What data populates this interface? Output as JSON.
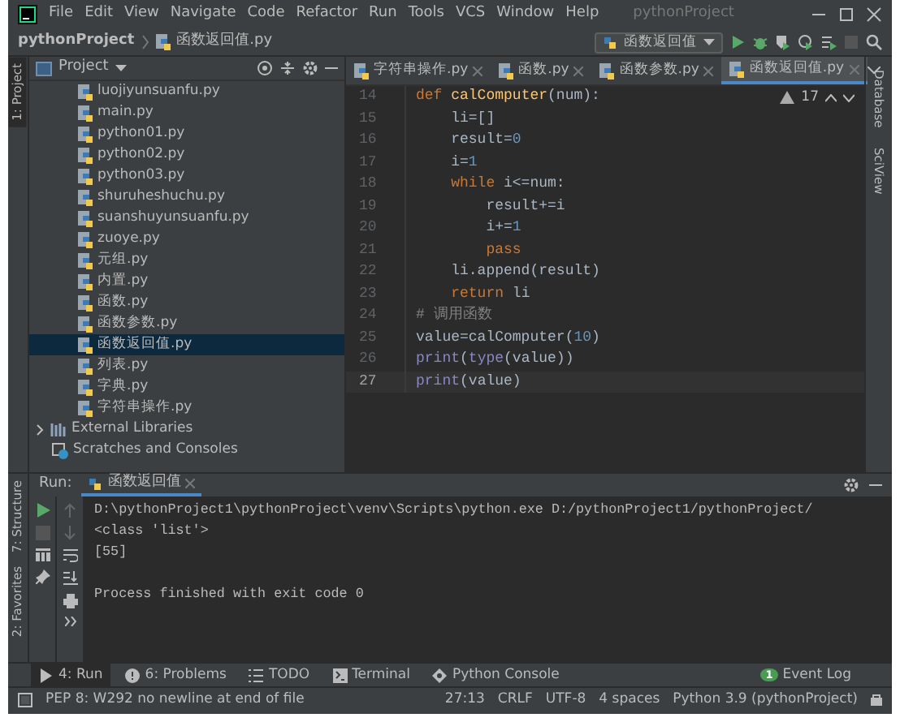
{
  "title_bar": {
    "menu": [
      "File",
      "Edit",
      "View",
      "Navigate",
      "Code",
      "Refactor",
      "Run",
      "Tools",
      "VCS",
      "Window",
      "Help"
    ],
    "title": "pythonProject"
  },
  "nav_bar": {
    "breadcrumb": [
      "pythonProject",
      "函数返回值.py"
    ],
    "run_config": "函数返回值"
  },
  "left_stripe": {
    "top": [
      "1: Project"
    ],
    "bottom": [
      "7: Structure",
      "2: Favorites"
    ]
  },
  "project_panel": {
    "title": "Project",
    "files": [
      {
        "label": "luojiyunsuanfu.py",
        "selected": false
      },
      {
        "label": "main.py",
        "selected": false
      },
      {
        "label": "python01.py",
        "selected": false
      },
      {
        "label": "python02.py",
        "selected": false
      },
      {
        "label": "python03.py",
        "selected": false
      },
      {
        "label": "shuruheshuchu.py",
        "selected": false
      },
      {
        "label": "suanshuyunsuanfu.py",
        "selected": false
      },
      {
        "label": "zuoye.py",
        "selected": false
      },
      {
        "label": "元组.py",
        "selected": false
      },
      {
        "label": "内置.py",
        "selected": false
      },
      {
        "label": "函数.py",
        "selected": false
      },
      {
        "label": "函数参数.py",
        "selected": false
      },
      {
        "label": "函数返回值.py",
        "selected": true
      },
      {
        "label": "列表.py",
        "selected": false
      },
      {
        "label": "字典.py",
        "selected": false
      },
      {
        "label": "字符串操作.py",
        "selected": false
      }
    ],
    "extras": [
      {
        "label": "External Libraries",
        "kind": "libraries"
      },
      {
        "label": "Scratches and Consoles",
        "kind": "scratches"
      }
    ]
  },
  "editor": {
    "tabs": [
      {
        "label": "字符串操作.py",
        "selected": false
      },
      {
        "label": "函数.py",
        "selected": false
      },
      {
        "label": "函数参数.py",
        "selected": false
      },
      {
        "label": "函数返回值.py",
        "selected": true
      }
    ],
    "warning_count": "17",
    "lines": [
      {
        "number": "14",
        "current": false,
        "tokens": [
          {
            "kind": "keyword",
            "text": "def "
          },
          {
            "kind": "function",
            "text": "calComputer"
          },
          {
            "kind": "plain",
            "text": "(num):"
          }
        ]
      },
      {
        "number": "15",
        "current": false,
        "tokens": [
          {
            "kind": "plain",
            "text": "    li=[]"
          }
        ]
      },
      {
        "number": "16",
        "current": false,
        "tokens": [
          {
            "kind": "plain",
            "text": "    result="
          },
          {
            "kind": "number",
            "text": "0"
          }
        ]
      },
      {
        "number": "17",
        "current": false,
        "tokens": [
          {
            "kind": "plain",
            "text": "    i="
          },
          {
            "kind": "number",
            "text": "1"
          }
        ]
      },
      {
        "number": "18",
        "current": false,
        "tokens": [
          {
            "kind": "keyword",
            "text": "    while"
          },
          {
            "kind": "plain",
            "text": " i<=num:"
          }
        ]
      },
      {
        "number": "19",
        "current": false,
        "tokens": [
          {
            "kind": "plain",
            "text": "        result+=i"
          }
        ]
      },
      {
        "number": "20",
        "current": false,
        "tokens": [
          {
            "kind": "plain",
            "text": "        i+="
          },
          {
            "kind": "number",
            "text": "1"
          }
        ]
      },
      {
        "number": "21",
        "current": false,
        "tokens": [
          {
            "kind": "keyword",
            "text": "        pass"
          }
        ]
      },
      {
        "number": "22",
        "current": false,
        "tokens": [
          {
            "kind": "plain",
            "text": "    li.append(result)"
          }
        ]
      },
      {
        "number": "23",
        "current": false,
        "tokens": [
          {
            "kind": "keyword",
            "text": "    return"
          },
          {
            "kind": "plain",
            "text": " li"
          }
        ]
      },
      {
        "number": "24",
        "current": false,
        "tokens": [
          {
            "kind": "comment",
            "text": "# 调用函数"
          }
        ]
      },
      {
        "number": "25",
        "current": false,
        "tokens": [
          {
            "kind": "plain",
            "text": "value=calComputer("
          },
          {
            "kind": "number",
            "text": "10"
          },
          {
            "kind": "plain",
            "text": ")"
          }
        ]
      },
      {
        "number": "26",
        "current": false,
        "tokens": [
          {
            "kind": "builtin",
            "text": "print"
          },
          {
            "kind": "plain",
            "text": "("
          },
          {
            "kind": "builtin",
            "text": "type"
          },
          {
            "kind": "plain",
            "text": "(value))"
          }
        ]
      },
      {
        "number": "27",
        "current": true,
        "tokens": [
          {
            "kind": "builtin",
            "text": "print"
          },
          {
            "kind": "plain",
            "text": "(value)"
          }
        ]
      }
    ]
  },
  "right_stripe": [
    "Database",
    "SciView"
  ],
  "run_panel": {
    "label": "Run:",
    "tab": "函数返回值",
    "output": [
      "D:\\pythonProject1\\pythonProject\\venv\\Scripts\\python.exe D:/pythonProject1/pythonProject/",
      "<class 'list'>",
      "[55]"
    ],
    "exit_message": "Process finished with exit code 0"
  },
  "tool_windows": [
    {
      "label": "4: Run",
      "kind": "run",
      "selected": true
    },
    {
      "label": "6: Problems",
      "kind": "problems",
      "selected": false
    },
    {
      "label": "TODO",
      "kind": "todo",
      "selected": false
    },
    {
      "label": "Terminal",
      "kind": "terminal",
      "selected": false
    },
    {
      "label": "Python Console",
      "kind": "console",
      "selected": false
    }
  ],
  "event_log": {
    "label": "Event Log",
    "count": "1"
  },
  "status_bar": {
    "message": "PEP 8: W292 no newline at end of file",
    "items": [
      "27:13",
      "CRLF",
      "UTF-8",
      "4 spaces",
      "Python 3.9 (pythonProject)"
    ]
  }
}
